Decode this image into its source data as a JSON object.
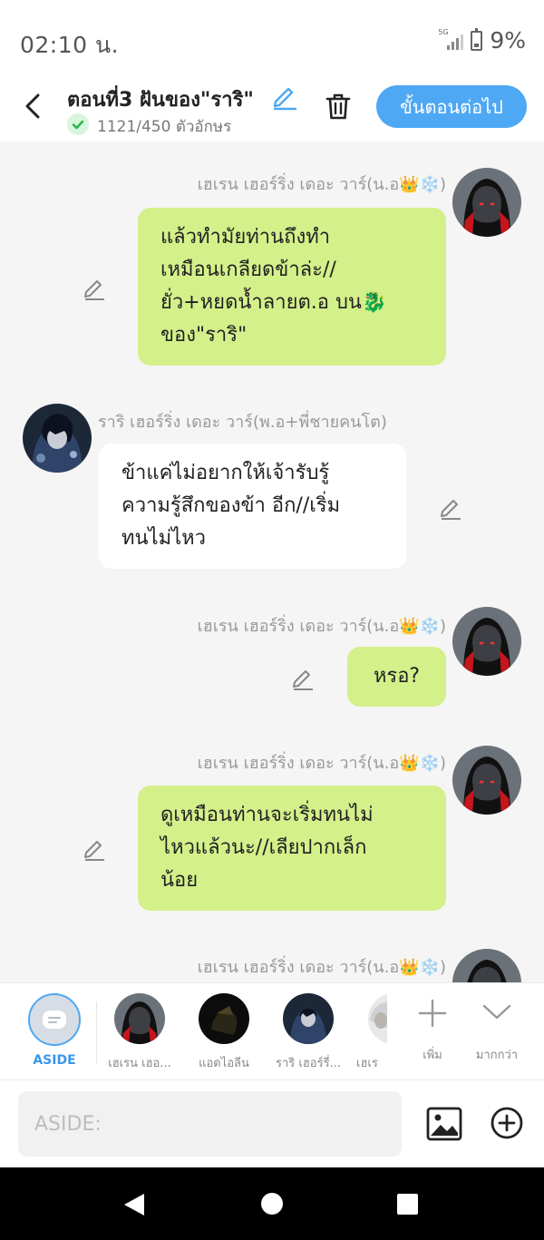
{
  "status": {
    "time": "02:10 น.",
    "network": "5G",
    "battery": "9%"
  },
  "header": {
    "title": "ตอนที่3 ฝันของ\"ราริ\"",
    "char_count": "1121/450 ตัวอักษร",
    "next_label": "ขั้นตอนต่อไป"
  },
  "messages": [
    {
      "sender": "เฮเรน เฮอร์ริ่ง เดอะ วาร์(น.อ👑❄️)",
      "text_lines": [
        "แล้วทำมัยท่านถึงทำ",
        "เหมือนเกลียดข้าล่ะ//",
        "ยั่ว+หยดน้ำลายต.อ บน🐉",
        "ของ\"ราริ\""
      ],
      "side": "right"
    },
    {
      "sender": "ราริ เฮอร์ริ่ง เดอะ วาร์(พ.อ+พี่ชายคนโต)",
      "text_lines": [
        "ข้าแค่ไม่อยากให้เจ้ารับรู้",
        "ความรู้สึกของข้า อีก//เริ่ม",
        "ทนไม่ไหว"
      ],
      "side": "left"
    },
    {
      "sender": "เฮเรน เฮอร์ริ่ง เดอะ วาร์(น.อ👑❄️)",
      "text_lines": [
        "หรอ?"
      ],
      "side": "right"
    },
    {
      "sender": "เฮเรน เฮอร์ริ่ง เดอะ วาร์(น.อ👑❄️)",
      "text_lines": [
        "ดูเหมือนท่านจะเริ่มทนไม่",
        "ไหวแล้วนะ//เลียปากเล็ก",
        "น้อย"
      ],
      "side": "right"
    },
    {
      "sender": "เฮเรน เฮอร์ริ่ง เดอะ วาร์(น.อ👑❄️)",
      "text_lines": [],
      "side": "right"
    }
  ],
  "character_bar": {
    "aside_label": "ASIDE",
    "characters": [
      {
        "name": "เฮเรน เฮอ...",
        "avatar": "red-hood-avatar"
      },
      {
        "name": "แอดไอลีน",
        "avatar": "dark-avatar"
      },
      {
        "name": "ราริ เฮอร์รี่...",
        "avatar": "blue-avatar"
      },
      {
        "name": "เฮเร",
        "avatar": "white-hair-avatar"
      }
    ],
    "add_label": "เพิ่ม",
    "more_label": "มากกว่า"
  },
  "input": {
    "placeholder": "ASIDE:",
    "value": ""
  },
  "colors": {
    "accent": "#4ea8f3",
    "my_bubble": "#d4f08a",
    "their_bubble": "#ffffff",
    "chat_bg": "#f5f5f5"
  }
}
